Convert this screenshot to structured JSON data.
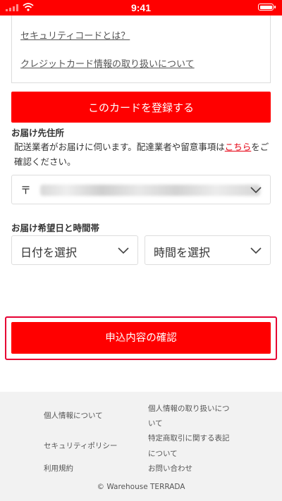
{
  "status_bar": {
    "time": "9:41"
  },
  "card_section": {
    "security_code_link": "セキュリティコードとは？",
    "card_info_link": "クレジットカード情報の取り扱いについて",
    "register_button": "このカードを登録する"
  },
  "delivery_address": {
    "title": "お届け先住所",
    "note_before": "配送業者がお届けに伺います。配達業者や留意事項は",
    "note_link": "こちら",
    "note_after": "をご確認ください。",
    "postal_mark": "〒"
  },
  "delivery_time": {
    "title": "お届け希望日と時間帯",
    "date_select": "日付を選択",
    "time_select": "時間を選択"
  },
  "confirm_button": "申込内容の確認",
  "footer": {
    "privacy_link": "個人情報について",
    "personal_info_handling_link_line1": "個人情報の取り扱いにつ",
    "personal_info_handling_link_line2": "いて",
    "security_policy_link": "セキュリティポリシー",
    "commercial_law_link_line1": "特定商取引に関する表記",
    "commercial_law_link_line2": "について",
    "terms_link": "利用規約",
    "contact_link": "お問い合わせ",
    "copyright": "© Warehouse TERRADA"
  },
  "colors": {
    "brand_red": "#ff0000",
    "highlight_border": "#e60033",
    "footer_bg": "#f2f2f2"
  },
  "icons": [
    "signal-icon",
    "wifi-icon",
    "battery-icon",
    "chevron-down-icon"
  ]
}
